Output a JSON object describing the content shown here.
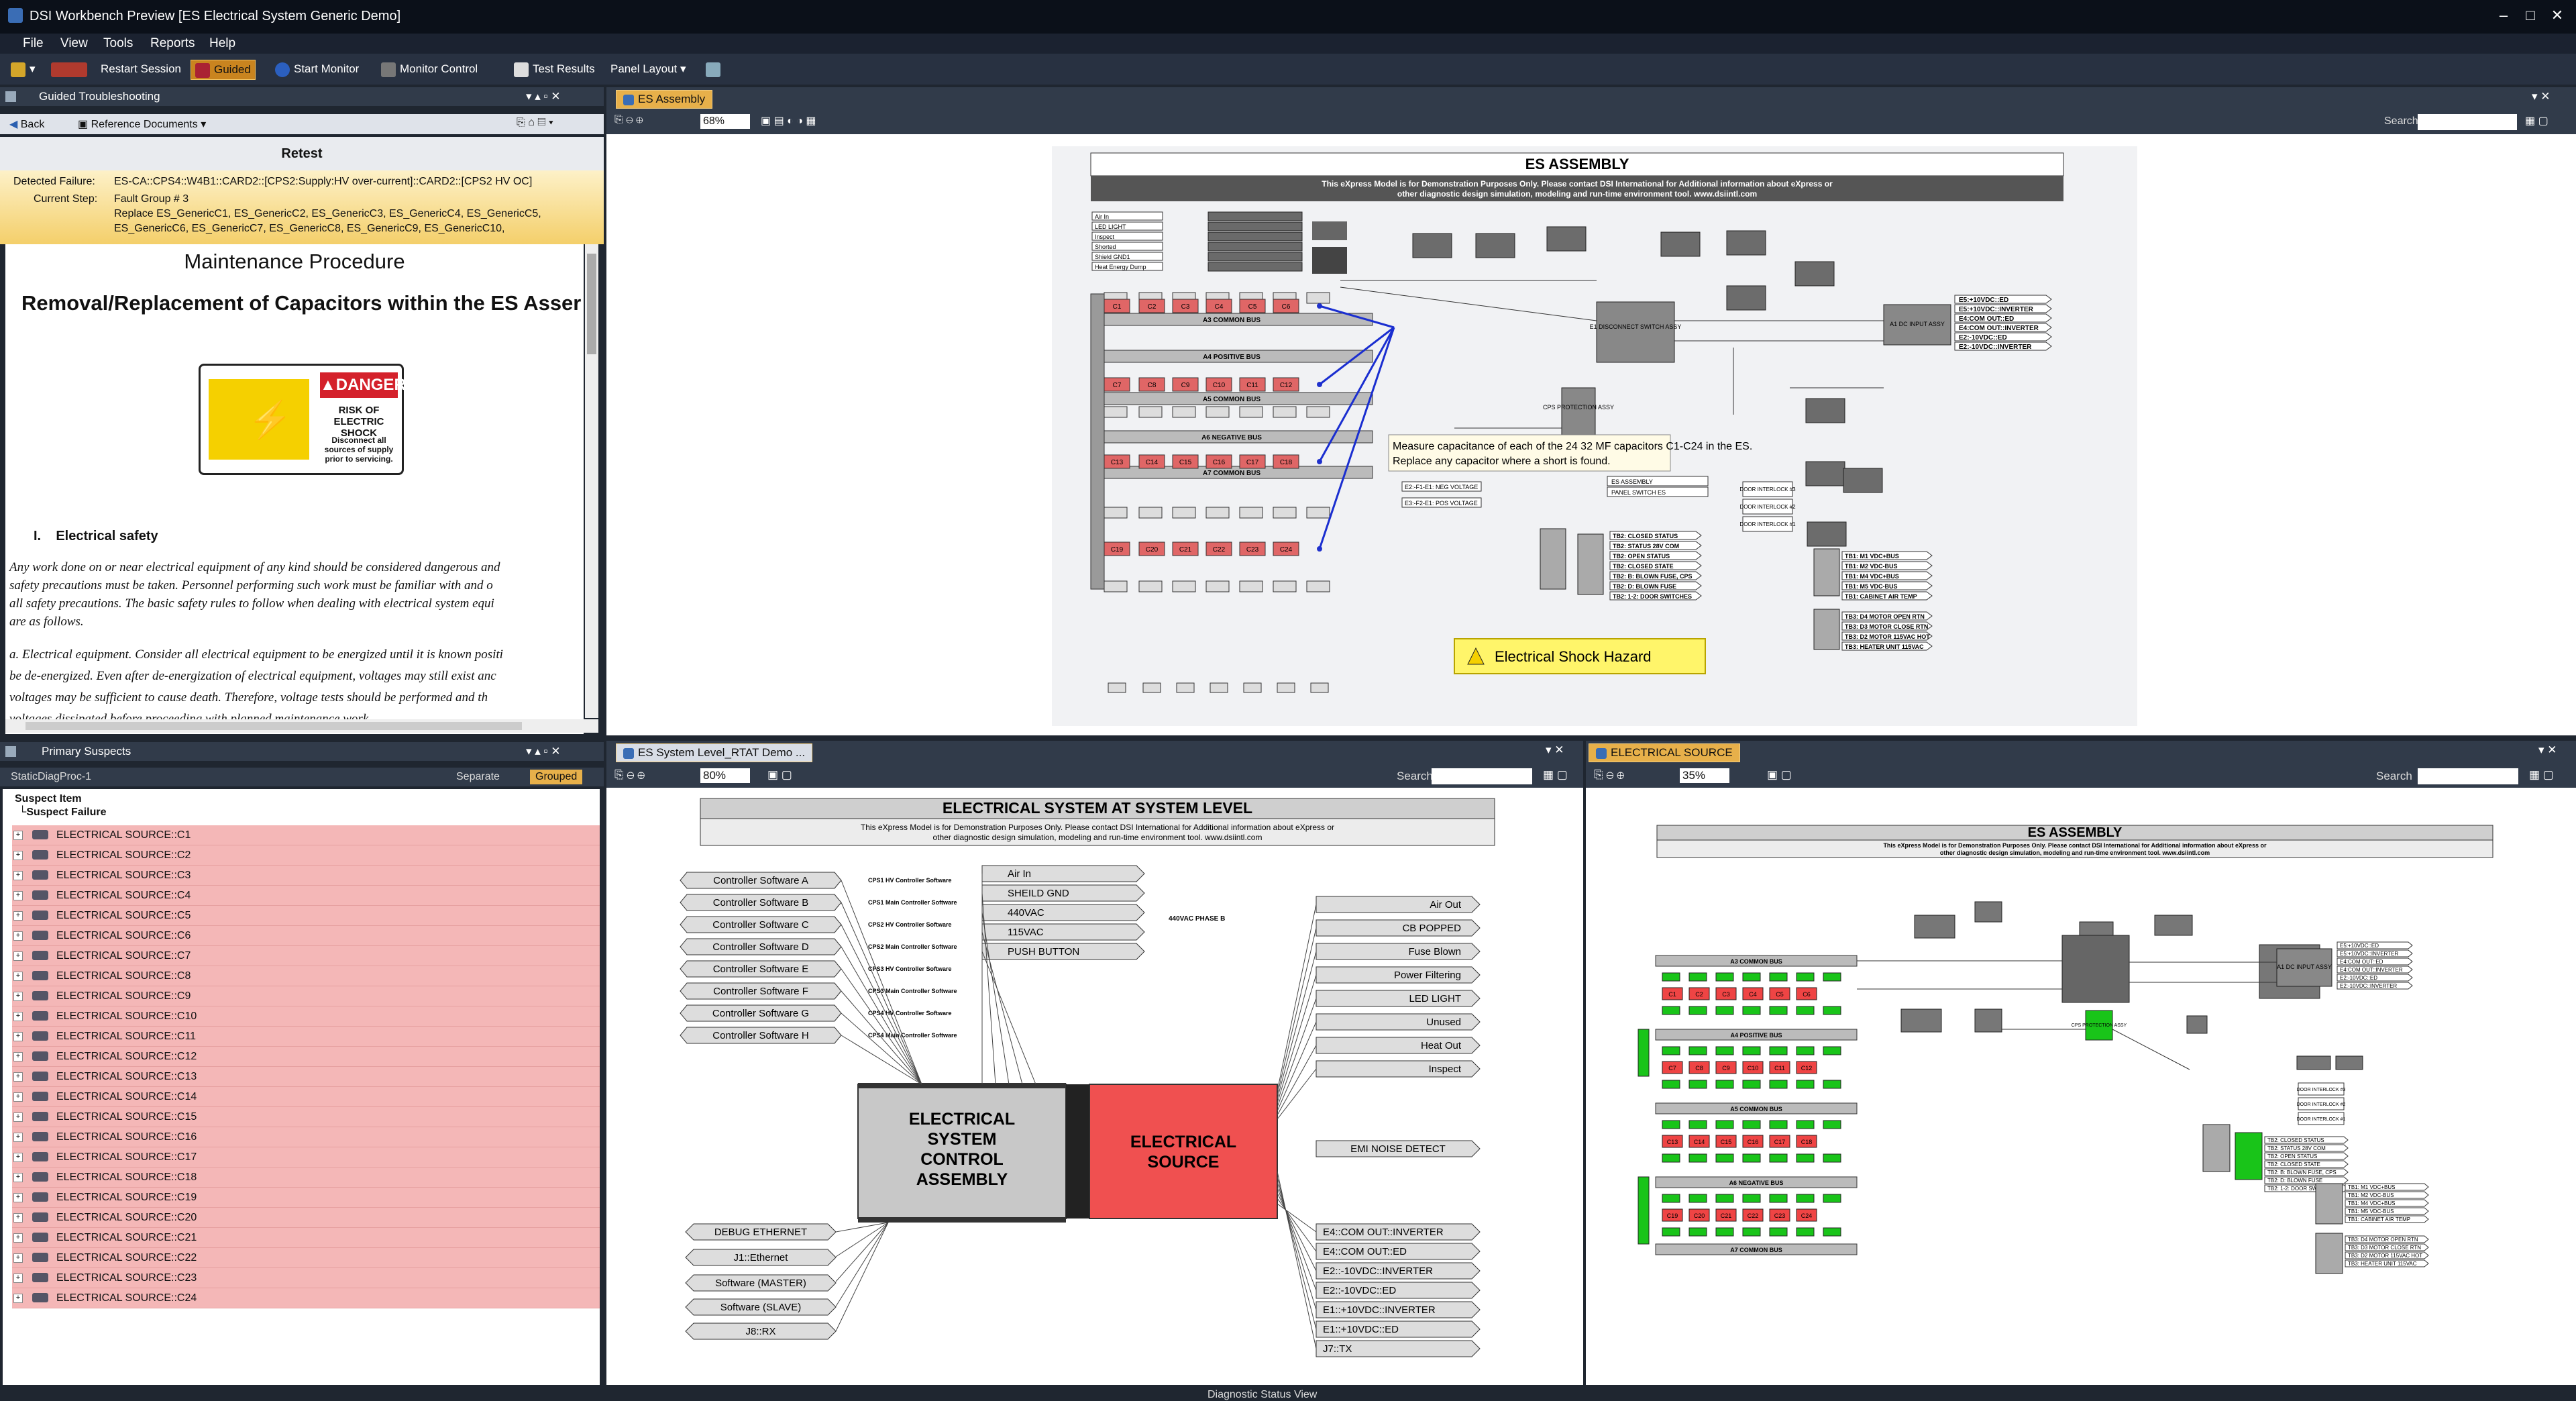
{
  "app": {
    "title": "DSI Workbench Preview [ES Electrical System Generic Demo]"
  },
  "menu": [
    "File",
    "View",
    "Tools",
    "Reports",
    "Help"
  ],
  "toolbar": {
    "restart": "Restart Session",
    "guided": "Guided",
    "start_monitor": "Start Monitor",
    "monitor_control": "Monitor Control",
    "test_results": "Test Results",
    "panel_layout": "Panel Layout"
  },
  "guided": {
    "panel_title": "Guided Troubleshooting",
    "back": "Back",
    "ref_docs": "Reference Documents",
    "retest": "Retest",
    "detected_label": "Detected Failure:",
    "detected_value": "ES-CA::CPS4::W4B1::CARD2::[CPS2:Supply:HV over-current]::CARD2::[CPS2 HV OC]",
    "step_label": "Current Step:",
    "step_line1": "Fault Group # 3",
    "step_line2": "Replace ES_GenericC1, ES_GenericC2, ES_GenericC3, ES_GenericC4, ES_GenericC5,",
    "step_line3": "ES_GenericC6, ES_GenericC7, ES_GenericC8, ES_GenericC9, ES_GenericC10,",
    "doc_title": "Maintenance Procedure",
    "doc_subtitle": "Removal/Replacement of Capacitors within the ES Asser",
    "danger_title": "DANGER",
    "danger_risk": "RISK OF ELECTRIC SHOCK",
    "danger_sub": "Disconnect all sources of supply prior to servicing.",
    "section": "I.    Electrical safety",
    "para1": [
      "Any work done on or near electrical equipment of any kind should be considered dangerous and",
      "safety precautions must be taken.  Personnel performing such work must be familiar with and o",
      "all safety precautions.  The basic safety rules to follow when dealing with electrical system equi",
      "are as follows."
    ],
    "para2": [
      "a. Electrical equipment. Consider all electrical equipment to be energized until it is known positi",
      "be de-energized.  Even after de-energization of electrical equipment, voltages may still exist anc",
      "voltages may be sufficient to cause death.  Therefore, voltage tests should be performed and th",
      "voltages dissipated before proceeding with planned maintenance work."
    ]
  },
  "suspects": {
    "panel_title": "Primary Suspects",
    "proc": "StaticDiagProc-1",
    "separate": "Separate",
    "grouped": "Grouped",
    "col1": "Suspect Item",
    "col2": "└Suspect Failure",
    "items": [
      "ELECTRICAL SOURCE::C1",
      "ELECTRICAL SOURCE::C2",
      "ELECTRICAL SOURCE::C3",
      "ELECTRICAL SOURCE::C4",
      "ELECTRICAL SOURCE::C5",
      "ELECTRICAL SOURCE::C6",
      "ELECTRICAL SOURCE::C7",
      "ELECTRICAL SOURCE::C8",
      "ELECTRICAL SOURCE::C9",
      "ELECTRICAL SOURCE::C10",
      "ELECTRICAL SOURCE::C11",
      "ELECTRICAL SOURCE::C12",
      "ELECTRICAL SOURCE::C13",
      "ELECTRICAL SOURCE::C14",
      "ELECTRICAL SOURCE::C15",
      "ELECTRICAL SOURCE::C16",
      "ELECTRICAL SOURCE::C17",
      "ELECTRICAL SOURCE::C18",
      "ELECTRICAL SOURCE::C19",
      "ELECTRICAL SOURCE::C20",
      "ELECTRICAL SOURCE::C21",
      "ELECTRICAL SOURCE::C22",
      "ELECTRICAL SOURCE::C23",
      "ELECTRICAL SOURCE::C24"
    ]
  },
  "es_assembly": {
    "tab": "ES Assembly",
    "zoom": "68%",
    "search": "Search",
    "title": "ES ASSEMBLY",
    "notice1": "This eXpress Model is for Demonstration Purposes Only.  Please contact DSI International for Additional information about eXpress or",
    "notice2": "other diagnostic design simulation, modeling and run-time environment tool.   www.dsiintl.com",
    "tooltip1": "Measure capacitance of each of the 24 32 MF capacitors C1-C24 in the ES.",
    "tooltip2": "Replace any capacitor where a short is found.",
    "hazard": "Electrical Shock Hazard",
    "busses": [
      "A3 COMMON BUS",
      "A4 POSITIVE BUS",
      "A5 COMMON BUS",
      "A6 NEGATIVE BUS",
      "A7 COMMON BUS"
    ],
    "caps": [
      "C1",
      "C2",
      "C3",
      "C4",
      "C5",
      "C6",
      "C7",
      "C8",
      "C9",
      "C10",
      "C11",
      "C12",
      "C13",
      "C14",
      "C15",
      "C16",
      "C17",
      "C18",
      "C19",
      "C20",
      "C21",
      "C22",
      "C23",
      "C24"
    ],
    "outs": [
      "E5:+10VDC::ED",
      "E5:+10VDC::INVERTER",
      "E4:COM OUT::ED",
      "E4:COM OUT::INVERTER",
      "E2:-10VDC::ED",
      "E2:-10VDC::INVERTER"
    ],
    "tb": [
      "TB2: CLOSED STATUS",
      "TB2: STATUS 28V COM",
      "TB2: OPEN STATUS",
      "TB2: CLOSED STATE",
      "TB2: B: BLOWN FUSE, CPS",
      "TB2: D: BLOWN FUSE",
      "TB2: 1-2: DOOR SWITCHES"
    ],
    "tb1": [
      "TB1: M1 VDC+BUS",
      "TB1: M2 VDC-BUS",
      "TB1: M4 VDC+BUS",
      "TB1: M5 VDC-BUS",
      "TB1: CABINET AIR TEMP"
    ],
    "tb3": [
      "TB3: D4 MOTOR OPEN RTN",
      "TB3: D3 MOTOR CLOSE RTN",
      "TB3: D2 MOTOR 115VAC HOT",
      "TB3: HEATER UNIT 115VAC"
    ],
    "misc": [
      "E1 DISCONNECT SWITCH ASSY",
      "A1 DC INPUT ASSY",
      "CPS PROTECTION ASSY",
      "E2:-F1-E1: NEG VOLTAGE",
      "E3:-F2-E1: POS VOLTAGE",
      "ES ASSEMBLY",
      "PANEL SWITCH ES",
      "DOOR INTERLOCK #3",
      "DOOR INTERLOCK #2",
      "DOOR INTERLOCK #1",
      "HEATER UNIT",
      "CABINET AIR TEMP",
      "Air In",
      "LED LIGHT",
      "Inspect",
      "Shorted",
      "Shield GND1",
      "Heat Energy Dump"
    ]
  },
  "system": {
    "tab": "ES System Level_RTAT Demo ...",
    "zoom": "80%",
    "search": "Search",
    "title": "ELECTRICAL SYSTEM  AT SYSTEM LEVEL",
    "notice1": "This eXpress Model is for Demonstration Purposes Only.  Please contact DSI International for Additional information about eXpress or",
    "notice2": "other diagnostic design simulation, modeling and run-time environment tool.   www.dsiintl.com",
    "controllers": [
      "Controller Software A",
      "Controller Software B",
      "Controller Software C",
      "Controller Software D",
      "Controller Software E",
      "Controller Software F",
      "Controller Software G",
      "Controller Software H"
    ],
    "ctrl_notes": [
      "CPS1 HV Controller Software",
      "CPS1 Main Controller Software",
      "CPS2 HV Controller Software",
      "CPS2 Main Controller Software",
      "CPS3 HV Controller Software",
      "CPS3 Main Controller Software",
      "CPS4 HV Controller Software",
      "CPS4 Main Controller Software"
    ],
    "inputs": [
      "Air In",
      "SHEILD GND",
      "440VAC",
      "115VAC",
      "PUSH BUTTON"
    ],
    "phase_note": "440VAC PHASE B",
    "outputs_top": [
      "Air Out",
      "CB POPPED",
      "Fuse Blown",
      "Power Filtering",
      "LED LIGHT",
      "Unused",
      "Heat Out",
      "Inspect"
    ],
    "control_block": "ELECTRICAL\nSYSTEM\nCONTROL\nASSEMBLY",
    "source_block": "ELECTRICAL\nSOURCE",
    "emi": "EMI NOISE DETECT",
    "left_bottom": [
      "DEBUG ETHERNET",
      "J1::Ethernet",
      "Software (MASTER)",
      "Software (SLAVE)",
      "J8::RX"
    ],
    "outputs_bottom": [
      "E4::COM OUT::INVERTER",
      "E4::COM OUT::ED",
      "E2::-10VDC::INVERTER",
      "E2::-10VDC::ED",
      "E1::+10VDC::INVERTER",
      "E1::+10VDC::ED",
      "J7::TX"
    ]
  },
  "source_panel": {
    "tab": "ELECTRICAL SOURCE",
    "zoom": "35%",
    "search": "Search",
    "title": "ES ASSEMBLY",
    "notice1": "This eXpress Model is for Demonstration Purposes Only.  Please contact DSI International for Additional information about eXpress or",
    "notice2": "other diagnostic design simulation, modeling and run-time environment tool.   www.dsiintl.com"
  },
  "status": "Diagnostic Status View",
  "colors": {
    "accent": "#e7b04a",
    "cap_red": "#e06666",
    "source_red": "#f05050",
    "green": "#19c419",
    "suspect_pink": "#f4b7b7"
  }
}
